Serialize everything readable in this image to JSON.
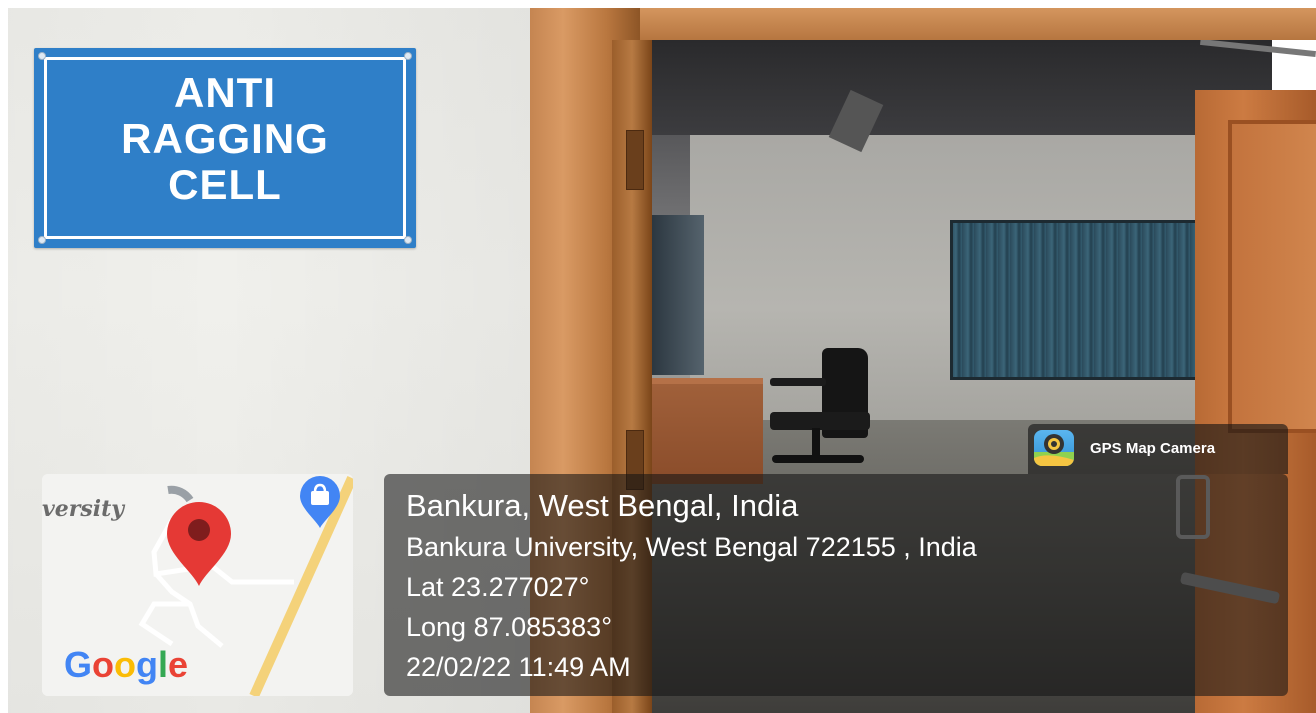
{
  "sign": {
    "line1": "ANTI",
    "line2": "RAGGING",
    "line3": "CELL"
  },
  "map": {
    "partial_label": "versity",
    "logo_letters": [
      "G",
      "o",
      "o",
      "g",
      "l",
      "e"
    ],
    "pin_color": "#e53935",
    "shop_icon_color": "#4285f4"
  },
  "gps_badge": {
    "label": "GPS Map Camera",
    "icon": "gps-map-camera-icon"
  },
  "location": {
    "title": "Bankura, West Bengal, India",
    "address": "Bankura University, West Bengal 722155 , India",
    "latitude": "Lat 23.277027°",
    "longitude": "Long 87.085383°",
    "timestamp": "22/02/22 11:49 AM"
  },
  "colors": {
    "sign_blue": "#2f7fc8",
    "door_wood": "#c58551",
    "overlay": "rgba(20,20,20,0.58)"
  }
}
